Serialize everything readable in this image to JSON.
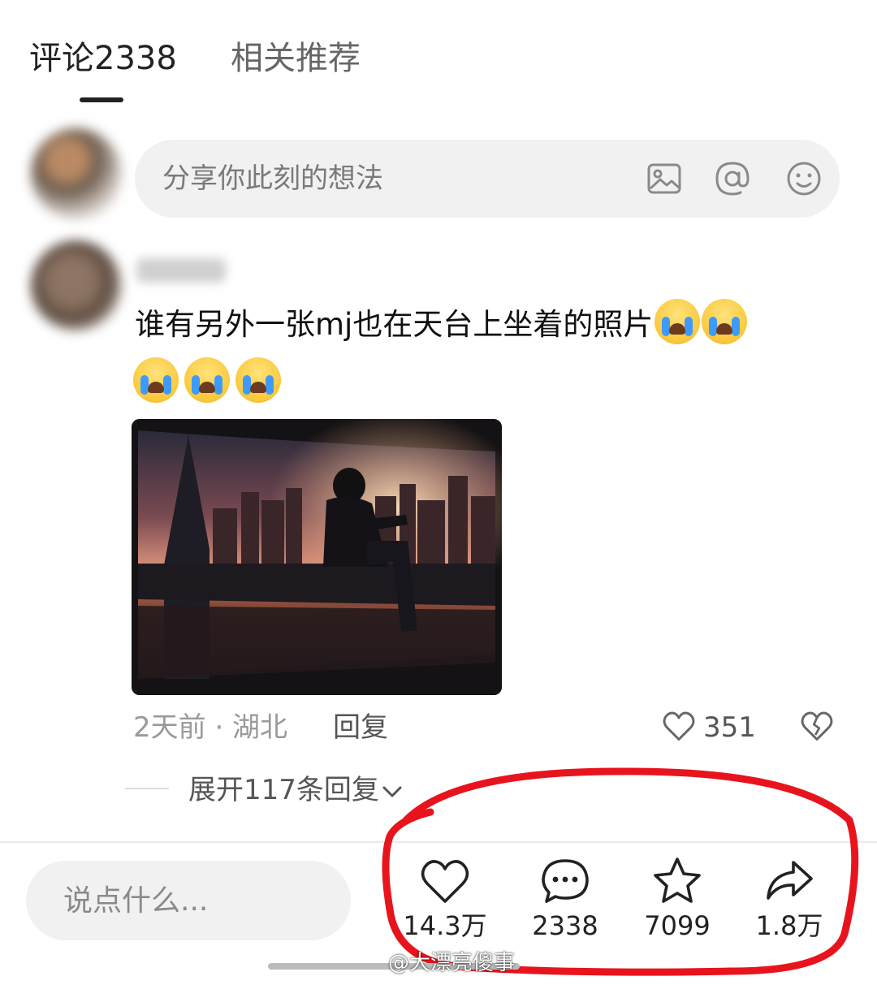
{
  "tabs": {
    "comments": "评论2338",
    "related": "相关推荐"
  },
  "input": {
    "placeholder": "分享你此刻的想法"
  },
  "comment": {
    "text": "谁有另外一张mj也在天台上坐着的照片",
    "emoji_count_inline": 2,
    "emoji_count_next_line": 3,
    "emoji": "loudly-crying-face",
    "time_location": "2天前 · 湖北",
    "reply_label": "回复",
    "like_count": "351",
    "expand_replies": "展开117条回复"
  },
  "bottom_bar": {
    "say_placeholder": "说点什么...",
    "likes": "14.3万",
    "comments": "2338",
    "favorites": "7099",
    "shares": "1.8万"
  },
  "watermark": "@大漂亮傻事",
  "colors": {
    "annotation": "#e8141d",
    "text": "#222222",
    "muted": "#9a9a9a",
    "surface": "#f1f1f1"
  }
}
